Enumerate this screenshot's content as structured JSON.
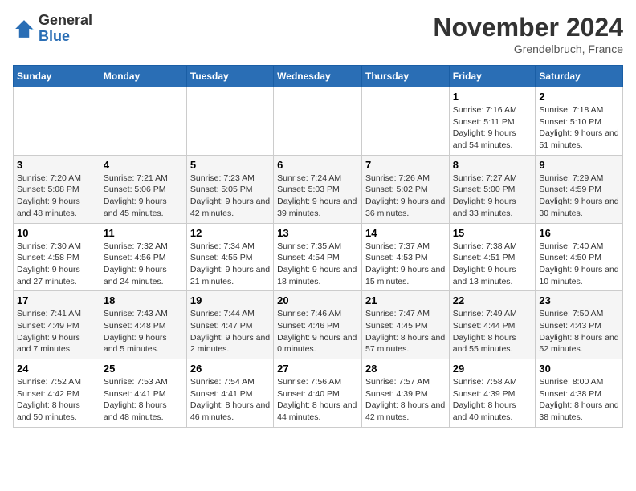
{
  "header": {
    "logo_general": "General",
    "logo_blue": "Blue",
    "month_title": "November 2024",
    "location": "Grendelbruch, France"
  },
  "days_of_week": [
    "Sunday",
    "Monday",
    "Tuesday",
    "Wednesday",
    "Thursday",
    "Friday",
    "Saturday"
  ],
  "weeks": [
    [
      {
        "day": "",
        "info": ""
      },
      {
        "day": "",
        "info": ""
      },
      {
        "day": "",
        "info": ""
      },
      {
        "day": "",
        "info": ""
      },
      {
        "day": "",
        "info": ""
      },
      {
        "day": "1",
        "info": "Sunrise: 7:16 AM\nSunset: 5:11 PM\nDaylight: 9 hours and 54 minutes."
      },
      {
        "day": "2",
        "info": "Sunrise: 7:18 AM\nSunset: 5:10 PM\nDaylight: 9 hours and 51 minutes."
      }
    ],
    [
      {
        "day": "3",
        "info": "Sunrise: 7:20 AM\nSunset: 5:08 PM\nDaylight: 9 hours and 48 minutes."
      },
      {
        "day": "4",
        "info": "Sunrise: 7:21 AM\nSunset: 5:06 PM\nDaylight: 9 hours and 45 minutes."
      },
      {
        "day": "5",
        "info": "Sunrise: 7:23 AM\nSunset: 5:05 PM\nDaylight: 9 hours and 42 minutes."
      },
      {
        "day": "6",
        "info": "Sunrise: 7:24 AM\nSunset: 5:03 PM\nDaylight: 9 hours and 39 minutes."
      },
      {
        "day": "7",
        "info": "Sunrise: 7:26 AM\nSunset: 5:02 PM\nDaylight: 9 hours and 36 minutes."
      },
      {
        "day": "8",
        "info": "Sunrise: 7:27 AM\nSunset: 5:00 PM\nDaylight: 9 hours and 33 minutes."
      },
      {
        "day": "9",
        "info": "Sunrise: 7:29 AM\nSunset: 4:59 PM\nDaylight: 9 hours and 30 minutes."
      }
    ],
    [
      {
        "day": "10",
        "info": "Sunrise: 7:30 AM\nSunset: 4:58 PM\nDaylight: 9 hours and 27 minutes."
      },
      {
        "day": "11",
        "info": "Sunrise: 7:32 AM\nSunset: 4:56 PM\nDaylight: 9 hours and 24 minutes."
      },
      {
        "day": "12",
        "info": "Sunrise: 7:34 AM\nSunset: 4:55 PM\nDaylight: 9 hours and 21 minutes."
      },
      {
        "day": "13",
        "info": "Sunrise: 7:35 AM\nSunset: 4:54 PM\nDaylight: 9 hours and 18 minutes."
      },
      {
        "day": "14",
        "info": "Sunrise: 7:37 AM\nSunset: 4:53 PM\nDaylight: 9 hours and 15 minutes."
      },
      {
        "day": "15",
        "info": "Sunrise: 7:38 AM\nSunset: 4:51 PM\nDaylight: 9 hours and 13 minutes."
      },
      {
        "day": "16",
        "info": "Sunrise: 7:40 AM\nSunset: 4:50 PM\nDaylight: 9 hours and 10 minutes."
      }
    ],
    [
      {
        "day": "17",
        "info": "Sunrise: 7:41 AM\nSunset: 4:49 PM\nDaylight: 9 hours and 7 minutes."
      },
      {
        "day": "18",
        "info": "Sunrise: 7:43 AM\nSunset: 4:48 PM\nDaylight: 9 hours and 5 minutes."
      },
      {
        "day": "19",
        "info": "Sunrise: 7:44 AM\nSunset: 4:47 PM\nDaylight: 9 hours and 2 minutes."
      },
      {
        "day": "20",
        "info": "Sunrise: 7:46 AM\nSunset: 4:46 PM\nDaylight: 9 hours and 0 minutes."
      },
      {
        "day": "21",
        "info": "Sunrise: 7:47 AM\nSunset: 4:45 PM\nDaylight: 8 hours and 57 minutes."
      },
      {
        "day": "22",
        "info": "Sunrise: 7:49 AM\nSunset: 4:44 PM\nDaylight: 8 hours and 55 minutes."
      },
      {
        "day": "23",
        "info": "Sunrise: 7:50 AM\nSunset: 4:43 PM\nDaylight: 8 hours and 52 minutes."
      }
    ],
    [
      {
        "day": "24",
        "info": "Sunrise: 7:52 AM\nSunset: 4:42 PM\nDaylight: 8 hours and 50 minutes."
      },
      {
        "day": "25",
        "info": "Sunrise: 7:53 AM\nSunset: 4:41 PM\nDaylight: 8 hours and 48 minutes."
      },
      {
        "day": "26",
        "info": "Sunrise: 7:54 AM\nSunset: 4:41 PM\nDaylight: 8 hours and 46 minutes."
      },
      {
        "day": "27",
        "info": "Sunrise: 7:56 AM\nSunset: 4:40 PM\nDaylight: 8 hours and 44 minutes."
      },
      {
        "day": "28",
        "info": "Sunrise: 7:57 AM\nSunset: 4:39 PM\nDaylight: 8 hours and 42 minutes."
      },
      {
        "day": "29",
        "info": "Sunrise: 7:58 AM\nSunset: 4:39 PM\nDaylight: 8 hours and 40 minutes."
      },
      {
        "day": "30",
        "info": "Sunrise: 8:00 AM\nSunset: 4:38 PM\nDaylight: 8 hours and 38 minutes."
      }
    ]
  ]
}
